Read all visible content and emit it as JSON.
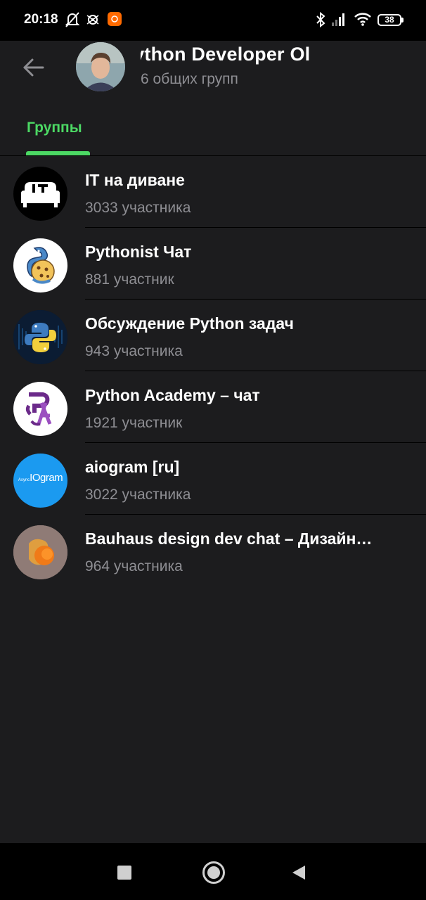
{
  "status": {
    "time": "20:18",
    "battery": "38"
  },
  "header": {
    "title": "Python Developer    Oleh Kopylov",
    "subtitle": "6 общих групп",
    "tab": "Группы"
  },
  "groups": [
    {
      "name": "IT на диване",
      "members": "3033 участника",
      "avatar": "sofa-it-logo"
    },
    {
      "name": "Pythonist Чат",
      "members": "881 участник",
      "avatar": "pythonist-cookie-logo"
    },
    {
      "name": "Обсуждение Python задач",
      "members": "943 участника",
      "avatar": "python-logo"
    },
    {
      "name": "Python Academy – чат",
      "members": "1921 участник",
      "avatar": "python-academy-logo"
    },
    {
      "name": "aiogram [ru]",
      "members": "3022 участника",
      "avatar": "aiogram-logo",
      "avatar_text_main": "IOgram",
      "avatar_text_small": "Async"
    },
    {
      "name": "Bauhaus design dev chat – Дизайн…",
      "members": "964 участника",
      "avatar": "bauhaus-logo"
    }
  ],
  "colors": {
    "accent": "#4cd964",
    "background": "#1c1c1e",
    "secondary_text": "#8e8e93"
  }
}
